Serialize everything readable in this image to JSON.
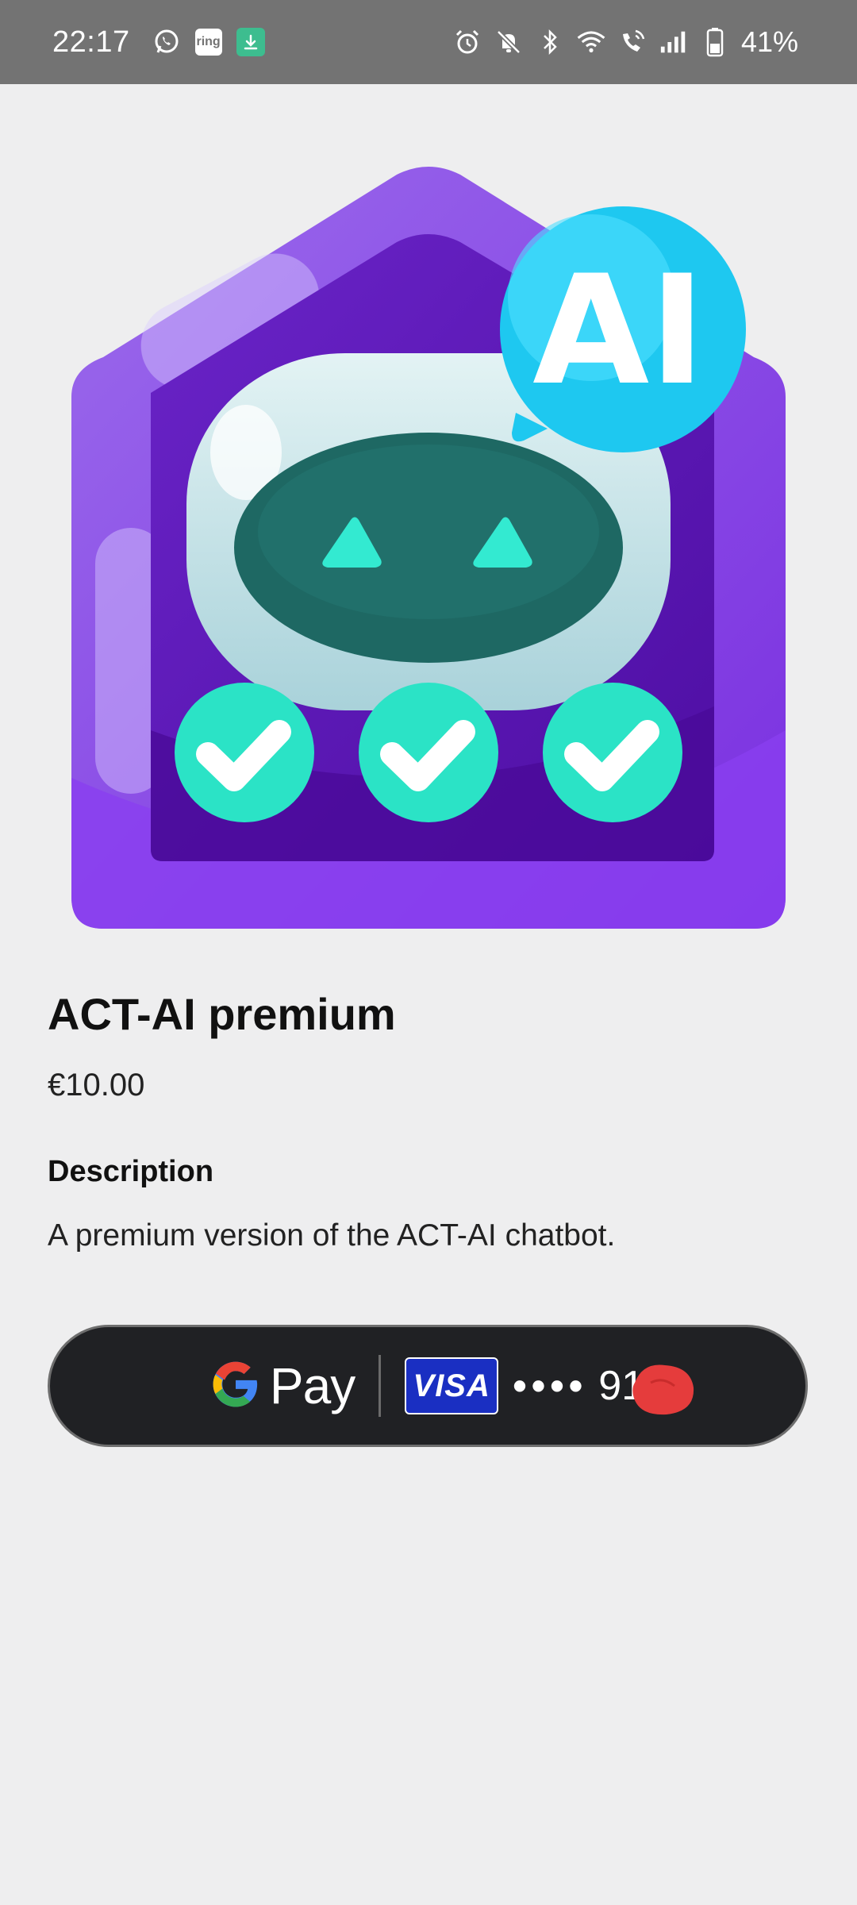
{
  "status_bar": {
    "time": "22:17",
    "battery_percent": "41%",
    "notification_icons": [
      "whatsapp-icon",
      "ring-icon",
      "download-icon"
    ],
    "ring_label": "ring",
    "system_icons": [
      "alarm-icon",
      "bell-off-icon",
      "bluetooth-icon",
      "wifi-icon",
      "wifi-calling-icon",
      "signal-icon",
      "battery-icon"
    ]
  },
  "product": {
    "title": "ACT-AI premium",
    "price": "€10.00",
    "image_badge_text": "AI"
  },
  "description": {
    "heading": "Description",
    "text": "A premium version of the ACT-AI chatbot."
  },
  "payment": {
    "pay_label": "Pay",
    "card_brand": "VISA",
    "card_mask": "••••",
    "card_digits": "91"
  },
  "colors": {
    "status_bar_bg": "#737373",
    "page_bg": "#eeeeef",
    "button_bg": "#202124",
    "visa_blue": "#1a2fc2",
    "purple": "#7b3fe4",
    "teal": "#2ee6c8",
    "ai_bubble": "#1ec8f0"
  }
}
